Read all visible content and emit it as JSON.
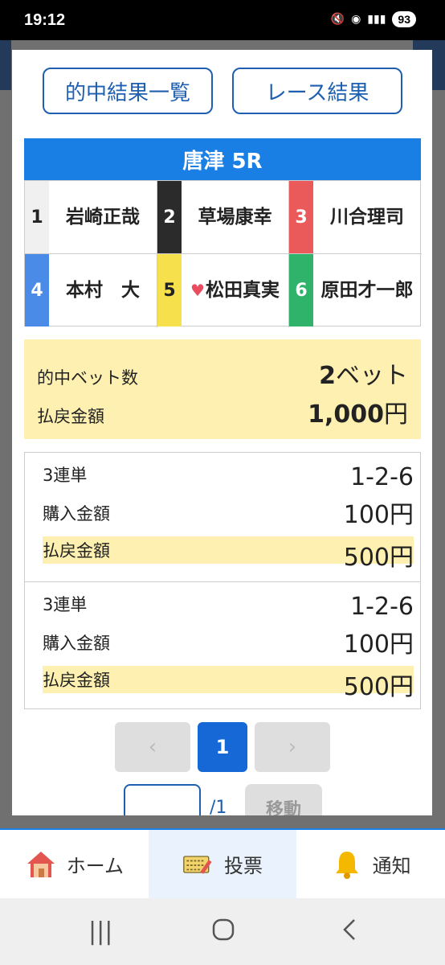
{
  "status": {
    "time": "19:12",
    "battery": "93"
  },
  "modal": {
    "buttons": {
      "hit_list": "的中結果一覧",
      "race_result": "レース結果"
    },
    "race_title": "唐津 5R",
    "racers": [
      {
        "num": "1",
        "name": "岩崎正哉"
      },
      {
        "num": "2",
        "name": "草場康幸"
      },
      {
        "num": "3",
        "name": "川合理司"
      },
      {
        "num": "4",
        "name": "本村　大"
      },
      {
        "num": "5",
        "name": "松田真実",
        "favorite": true
      },
      {
        "num": "6",
        "name": "原田才一郎"
      }
    ],
    "summary": {
      "hit_count_label": "的中ベット数",
      "hit_count_value": "2",
      "hit_count_unit": "ベット",
      "payout_label": "払戻金額",
      "payout_value": "1,000",
      "payout_unit": "円"
    },
    "bets": [
      {
        "type": "3連単",
        "combo": "1-2-6",
        "purchase_label": "購入金額",
        "purchase": "100円",
        "payout_label": "払戻金額",
        "payout": "500円"
      },
      {
        "type": "3連単",
        "combo": "1-2-6",
        "purchase_label": "購入金額",
        "purchase": "100円",
        "payout_label": "払戻金額",
        "payout": "500円"
      }
    ],
    "pager": {
      "prev": "‹",
      "current": "1",
      "next": "›",
      "total": "/1",
      "go": "移動"
    }
  },
  "bottom_nav": [
    {
      "label": "ホーム",
      "icon": "home-icon"
    },
    {
      "label": "投票",
      "icon": "ticket-icon",
      "active": true
    },
    {
      "label": "通知",
      "icon": "bell-icon"
    }
  ],
  "colors": {
    "accent": "#1a7fe5",
    "highlight": "#fdf0b0",
    "link": "#1f5fb0"
  }
}
